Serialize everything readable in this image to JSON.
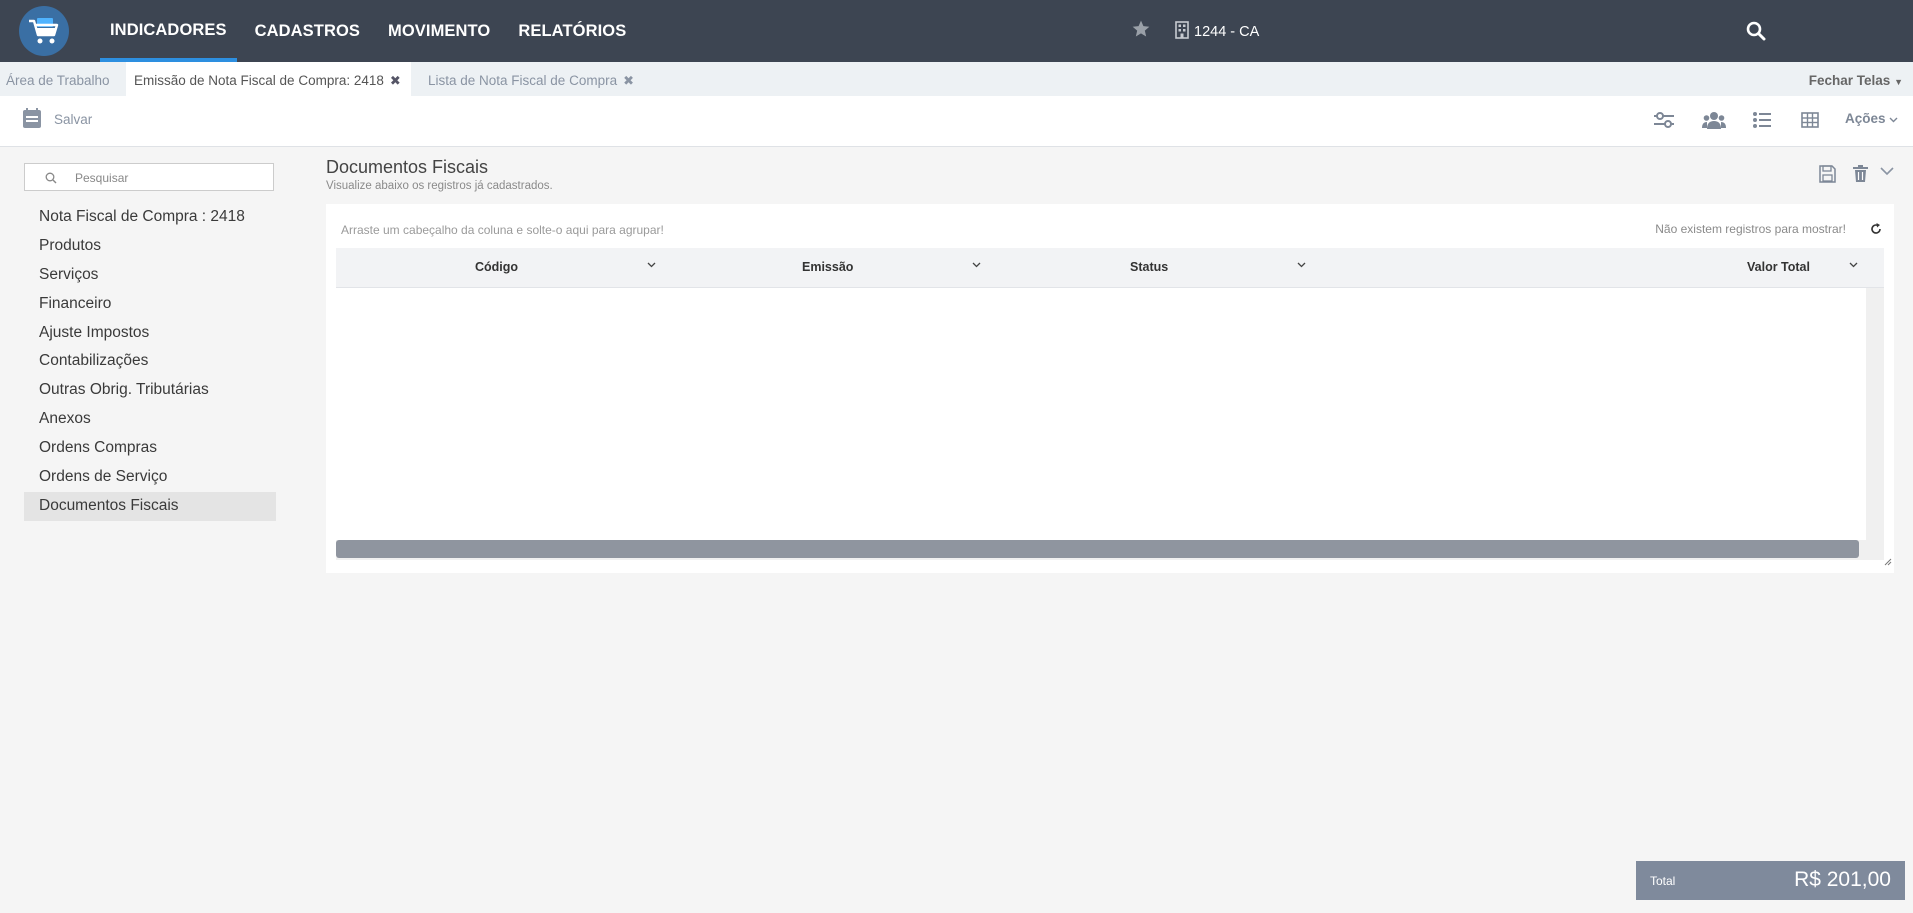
{
  "nav": {
    "items": [
      {
        "label": "INDICADORES",
        "active": true
      },
      {
        "label": "CADASTROS",
        "active": false
      },
      {
        "label": "MOVIMENTO",
        "active": false
      },
      {
        "label": "RELATÓRIOS",
        "active": false
      }
    ],
    "company": "1244 - CA",
    "icons": [
      "shopping-cart-icon",
      "star-icon",
      "building-icon",
      "search-icon"
    ]
  },
  "tabs": {
    "items": [
      {
        "label": "Área de Trabalho",
        "closable": false,
        "active": false
      },
      {
        "label": "Emissão de Nota Fiscal de Compra: 2418",
        "closable": true,
        "active": true
      },
      {
        "label": "Lista de Nota Fiscal de Compra",
        "closable": true,
        "active": false
      }
    ],
    "close_glyph": "✖",
    "close_all": "Fechar Telas"
  },
  "toolbar": {
    "save_label": "Salvar",
    "actions_label": "Ações"
  },
  "sidebar": {
    "search_placeholder": "Pesquisar",
    "items": [
      {
        "label": "Nota Fiscal de Compra : 2418",
        "active": false
      },
      {
        "label": "Produtos",
        "active": false
      },
      {
        "label": "Serviços",
        "active": false
      },
      {
        "label": "Financeiro",
        "active": false
      },
      {
        "label": "Ajuste Impostos",
        "active": false
      },
      {
        "label": "Contabilizações",
        "active": false
      },
      {
        "label": "Outras Obrig. Tributárias",
        "active": false
      },
      {
        "label": "Anexos",
        "active": false
      },
      {
        "label": "Ordens Compras",
        "active": false
      },
      {
        "label": "Ordens de Serviço",
        "active": false
      },
      {
        "label": "Documentos Fiscais",
        "active": true
      }
    ]
  },
  "panel": {
    "title": "Documentos Fiscais",
    "subtitle": "Visualize abaixo os registros já cadastrados.",
    "group_hint": "Arraste um cabeçalho da coluna e solte-o aqui para agrupar!",
    "no_records": "Não existem registros para mostrar!",
    "columns": [
      "Código",
      "Emissão",
      "Status",
      "Valor Total"
    ],
    "rows": []
  },
  "total": {
    "label": "Total",
    "value": "R$ 201,00"
  },
  "colors": {
    "topbar": "#3d4552",
    "accent": "#2d8fe0",
    "total_bg": "#7f8a9c"
  }
}
